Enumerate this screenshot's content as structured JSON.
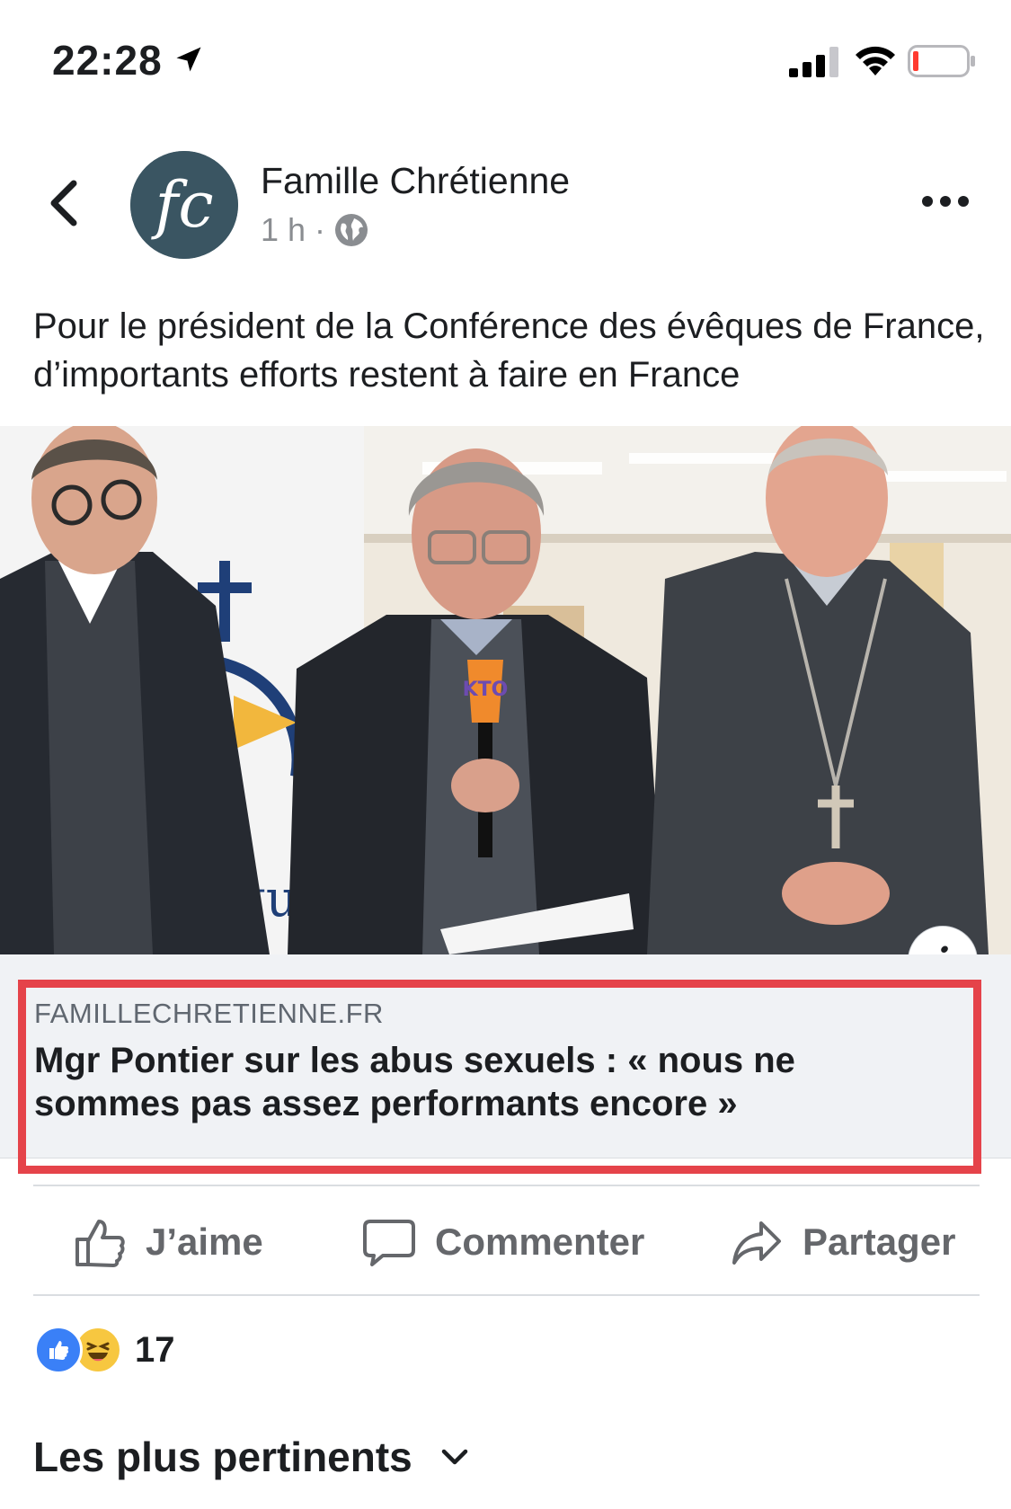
{
  "status_bar": {
    "time": "22:28",
    "location_icon": "location-arrow-icon",
    "signal_icon": "cellular-signal-icon",
    "wifi_icon": "wifi-icon",
    "battery_icon": "battery-low-icon"
  },
  "header": {
    "back_icon": "chevron-left-icon",
    "avatar_text": "fc",
    "page_name": "Famille Chrétienne",
    "time_ago": "1 h",
    "separator": "·",
    "audience_icon": "globe-icon",
    "more_icon": "more-dots-icon"
  },
  "post": {
    "text": "Pour le président de la Conférence des évêques de France, d’importants efforts restent à faire en France"
  },
  "image": {
    "logo_text": "ques",
    "mic_text": "KTO",
    "info_label": "i"
  },
  "link_preview": {
    "domain": "FAMILLECHRETIENNE.FR",
    "title": "Mgr Pontier sur les abus sexuels : « nous ne sommes pas assez performants encore »",
    "highlight_color": "#e5434a"
  },
  "actions": {
    "like_label": "J’aime",
    "comment_label": "Commenter",
    "share_label": "Partager"
  },
  "reactions": {
    "count": "17",
    "types": [
      "like",
      "haha"
    ]
  },
  "comments": {
    "sort_label": "Les plus pertinents"
  },
  "colors": {
    "accent_like": "#3a80f7",
    "haha": "#f7c740",
    "muted_text": "#65676b",
    "avatar_bg": "#3a5562"
  }
}
